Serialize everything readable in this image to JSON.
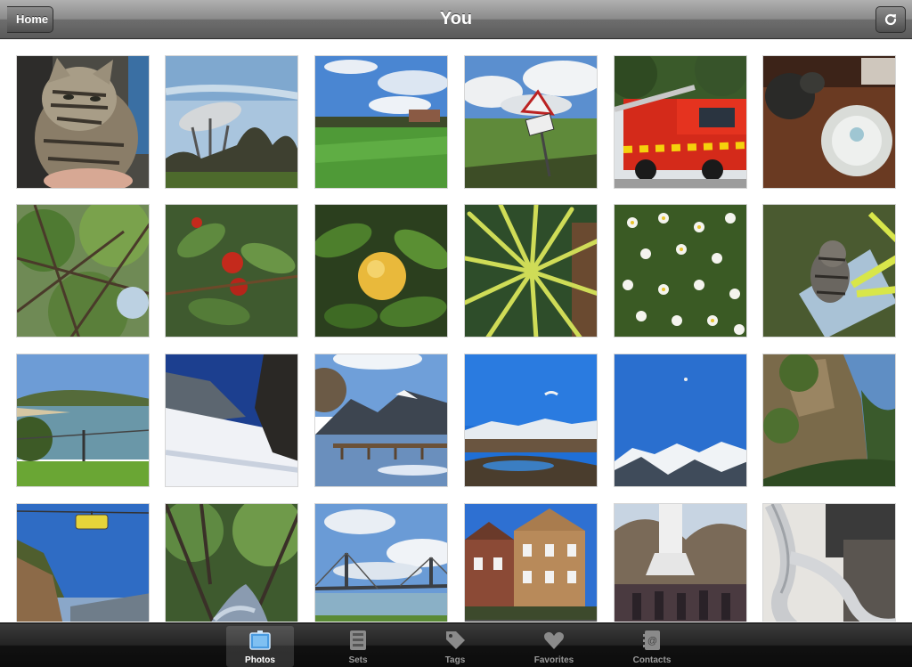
{
  "navbar": {
    "title": "You",
    "back_label": "Home"
  },
  "photos": [
    {
      "label": "cat on lap"
    },
    {
      "label": "radio telescope"
    },
    {
      "label": "green park"
    },
    {
      "label": "road sign in field"
    },
    {
      "label": "fire engine"
    },
    {
      "label": "cat and robot vacuum"
    },
    {
      "label": "tree branches"
    },
    {
      "label": "red berries"
    },
    {
      "label": "orange fruit on tree"
    },
    {
      "label": "spiky palm leaves"
    },
    {
      "label": "daisies"
    },
    {
      "label": "cat on paving stone"
    },
    {
      "label": "coastal bay"
    },
    {
      "label": "snowy cliff"
    },
    {
      "label": "lake pier and mountains"
    },
    {
      "label": "paraglider over mountains"
    },
    {
      "label": "snow capped mountains"
    },
    {
      "label": "rock pinnacles"
    },
    {
      "label": "cable car"
    },
    {
      "label": "rainforest creek"
    },
    {
      "label": "harbour bridge"
    },
    {
      "label": "victorian building"
    },
    {
      "label": "monument and crowd"
    },
    {
      "label": "spiral slides"
    }
  ],
  "tabs": [
    {
      "label": "Photos",
      "icon": "photos-icon",
      "selected": true
    },
    {
      "label": "Sets",
      "icon": "sets-icon",
      "selected": false
    },
    {
      "label": "Tags",
      "icon": "tag-icon",
      "selected": false
    },
    {
      "label": "Favorites",
      "icon": "heart-icon",
      "selected": false
    },
    {
      "label": "Contacts",
      "icon": "contacts-icon",
      "selected": false
    }
  ]
}
